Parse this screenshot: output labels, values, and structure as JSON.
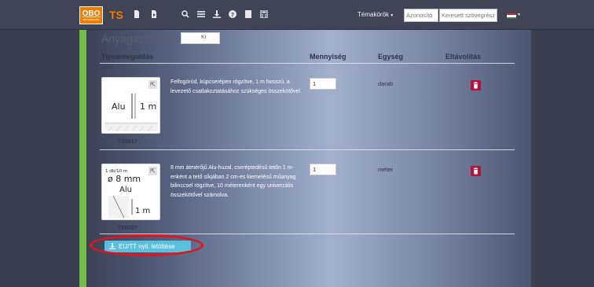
{
  "header": {
    "logo_text": "OBO",
    "logo_sub": "BETTERMANN",
    "app_name": "TS",
    "topics_label": "Témakörök",
    "topics_caret": "▾",
    "id_placeholder": "Azonosító",
    "search_placeholder": "Keresett szövegrész",
    "flag_colors": [
      "#ce2939",
      "#ffffff",
      "#477050"
    ],
    "icons": [
      "document-icon",
      "document-arrow-icon",
      "search-icon",
      "list-icon",
      "download-icon",
      "help-icon",
      "file-icon",
      "calculator-icon"
    ]
  },
  "section": {
    "title": "Anyagszükséglet",
    "toggle_label": "Ki"
  },
  "table": {
    "columns": {
      "solution": "Típusmegoldás",
      "quantity": "Mennyiség",
      "unit": "Egység",
      "remove": "Eltávolítás"
    },
    "rows": [
      {
        "code": "TS0017",
        "card_text_main": "Alu",
        "card_text_side": "1 m",
        "description": "Felfogórúd, kúpcserépen rögzítve, 1 m hosszú, a levezető csatlakoztatásához szükséges összekötővel.",
        "quantity": "1",
        "unit": "darab"
      },
      {
        "code": "TS0027",
        "card_note": "1 db/10 m",
        "card_text_main": "ø 8 mm",
        "card_text_sub": "Alu",
        "card_text_side": "1 m",
        "description": "8 mm átmérőjű Alu-huzal, cseréptedésű tetőn 1 m-enként a tető síkjában 2 cm-es kiemelésű műanyag bilinccsel rögzítve, 10 méterenként egy univerzális összekötővel számolva.",
        "quantity": "1",
        "unit": "méter"
      }
    ]
  },
  "actions": {
    "download_label": "EU/TT nyil. letöltése"
  },
  "colors": {
    "accent_orange": "#f07d00",
    "sidebar_green": "#6fbe45",
    "delete_red": "#b3123a",
    "download_blue": "#5bc0de",
    "highlight_red": "#e3121c"
  }
}
